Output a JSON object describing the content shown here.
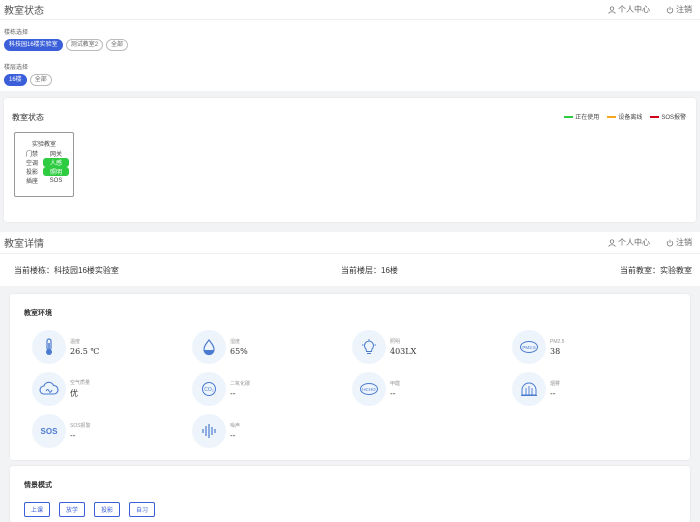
{
  "top_header": {
    "title": "教室状态",
    "profile": "个人中心",
    "logout": "注销"
  },
  "filters": {
    "building_label": "楼栋选择",
    "buildings": [
      "科技园16楼实验室",
      "测试教室2",
      "全部"
    ],
    "floor_label": "楼层选择",
    "floors": [
      "16楼",
      "全部"
    ]
  },
  "status_panel": {
    "title": "教室状态",
    "legend": [
      {
        "label": "正在使用",
        "color": "#2ecc40"
      },
      {
        "label": "设备离线",
        "color": "#f5a623"
      },
      {
        "label": "SOS报警",
        "color": "#d0021b"
      }
    ],
    "room": {
      "name": "实验教室",
      "rows": [
        {
          "k": "门禁",
          "v": "网关",
          "on": false
        },
        {
          "k": "空调",
          "v": "人感",
          "on": true
        },
        {
          "k": "投影",
          "v": "照明",
          "on": true
        },
        {
          "k": "插座",
          "v": "SOS",
          "on": false
        }
      ]
    }
  },
  "detail_header": {
    "title": "教室详情",
    "profile": "个人中心",
    "logout": "注销"
  },
  "info": {
    "building": "当前楼栋：科技园16楼实验室",
    "floor": "当前楼层：16楼",
    "room": "当前教室：实验教室"
  },
  "env": {
    "title": "教室环境",
    "sensors": [
      {
        "name": "温度",
        "value": "26.5 ℃",
        "icon": "thermometer-icon"
      },
      {
        "name": "湿度",
        "value": "65%",
        "icon": "water-drop-icon"
      },
      {
        "name": "照明",
        "value": "403LX",
        "icon": "light-bulb-icon"
      },
      {
        "name": "PM2.5",
        "value": "38",
        "icon": "pm25-icon"
      },
      {
        "name": "空气质量",
        "value": "优",
        "icon": "cloud-icon"
      },
      {
        "name": "二氧化碳",
        "value": "--",
        "icon": "co2-icon"
      },
      {
        "name": "甲醛",
        "value": "--",
        "icon": "hcho-icon"
      },
      {
        "name": "烟雾",
        "value": "--",
        "icon": "smoke-icon"
      },
      {
        "name": "SOS报警",
        "value": "--",
        "icon": "sos-icon"
      },
      {
        "name": "噪声",
        "value": "--",
        "icon": "noise-icon"
      }
    ],
    "glyphs": {
      "pm": "PM2.5",
      "co2": "CO₂",
      "hcho": "HCHO",
      "sos": "SOS"
    }
  },
  "scene": {
    "title": "情景模式",
    "modes": [
      "上课",
      "放学",
      "投影",
      "自习"
    ]
  },
  "colors": {
    "accent": "#3a5fd9",
    "icon_blue": "#4a7bd0",
    "icon_bg": "#eef4fb"
  }
}
